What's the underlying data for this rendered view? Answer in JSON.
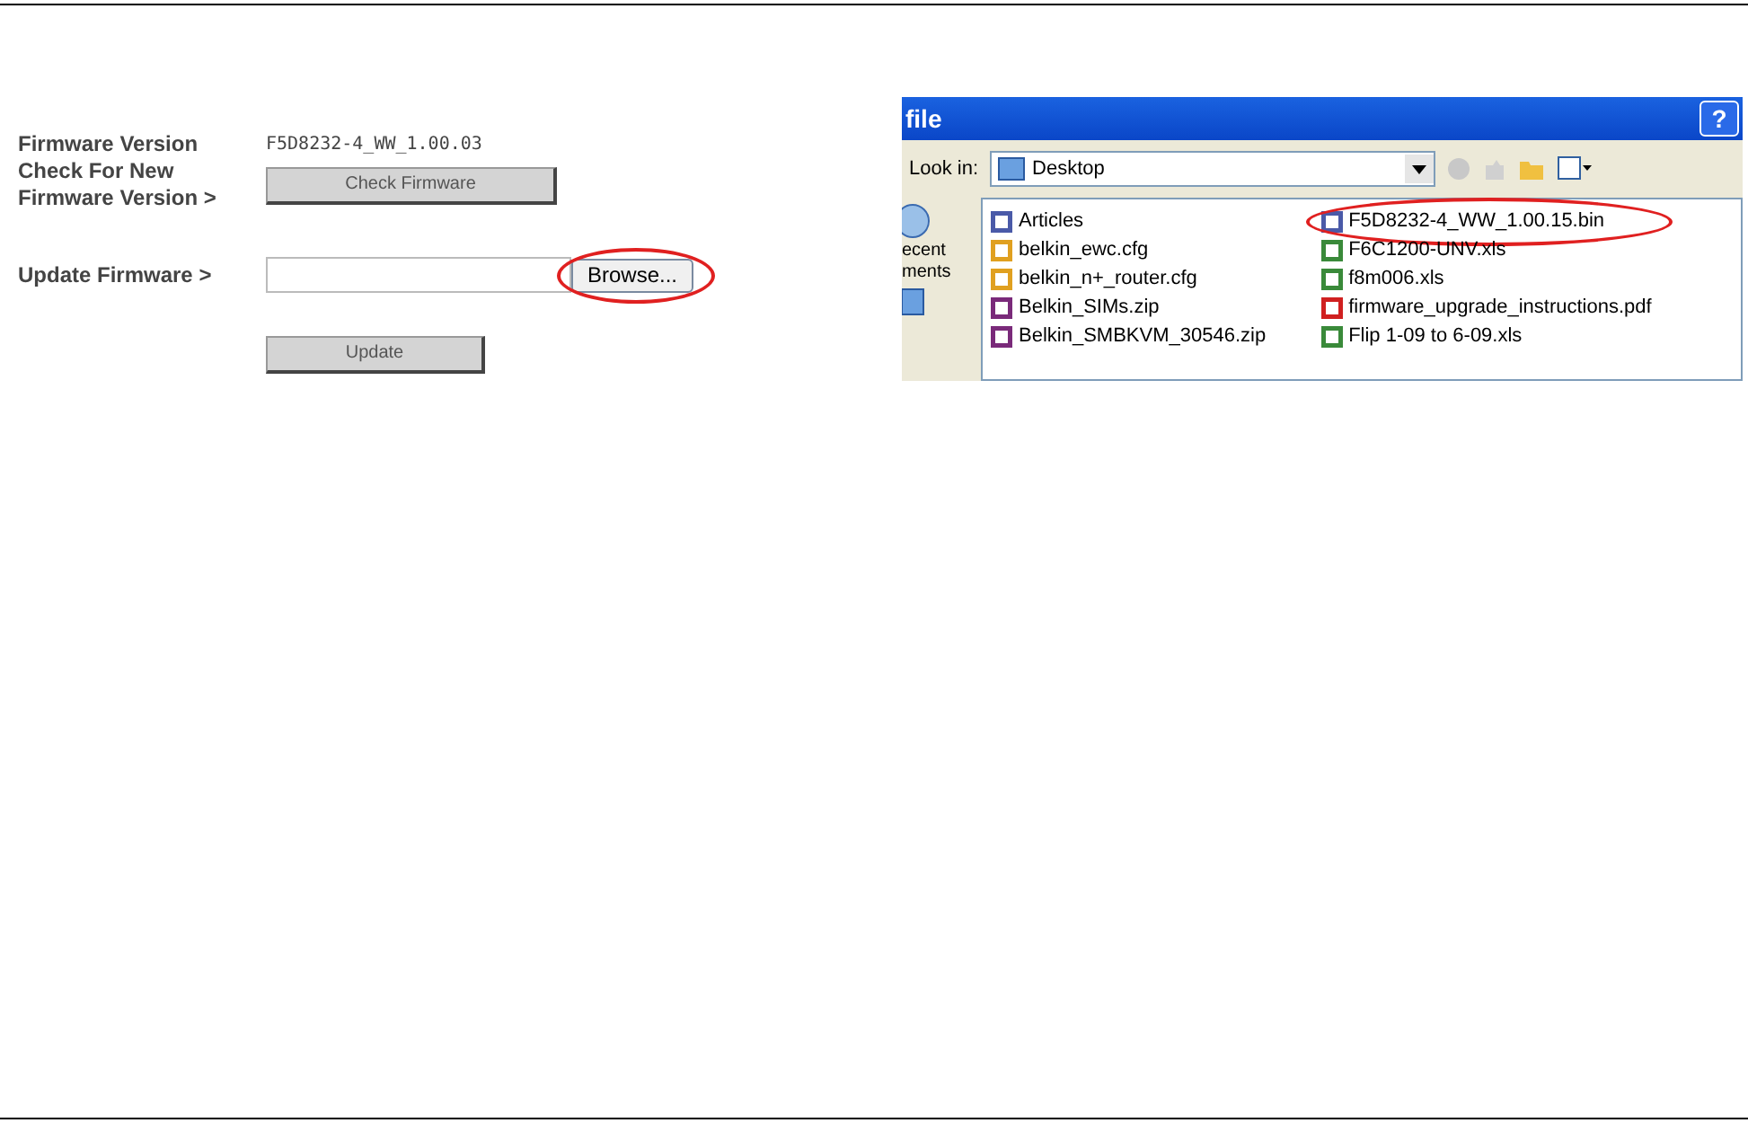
{
  "firmware_form": {
    "rows": [
      {
        "kind": "text",
        "label": "Firmware Version",
        "value": "F5D8232-4_WW_1.00.03"
      },
      {
        "kind": "button",
        "label": "Check For New Firmware Version >",
        "button": "Check Firmware"
      },
      {
        "kind": "file",
        "label": "Update Firmware >",
        "button": "Browse...",
        "placeholder": "",
        "highlighted": true
      },
      {
        "kind": "button",
        "label": "",
        "button": "Update"
      }
    ]
  },
  "file_dialog": {
    "title": "file",
    "help": "?",
    "look_in_label": "Look in:",
    "look_in_value": "Desktop",
    "places": [
      "ecent",
      "ments"
    ],
    "files": [
      {
        "name": "Articles",
        "kind": "bin",
        "highlighted": false
      },
      {
        "name": "belkin_ewc.cfg",
        "kind": "cfg",
        "highlighted": false
      },
      {
        "name": "belkin_n+_router.cfg",
        "kind": "cfg",
        "highlighted": false
      },
      {
        "name": "Belkin_SIMs.zip",
        "kind": "zip",
        "highlighted": false
      },
      {
        "name": "Belkin_SMBKVM_30546.zip",
        "kind": "zip",
        "highlighted": false
      },
      {
        "name": "F5D8232-4_WW_1.00.15.bin",
        "kind": "bin",
        "highlighted": true
      },
      {
        "name": "F6C1200-UNV.xls",
        "kind": "xls",
        "highlighted": false
      },
      {
        "name": "f8m006.xls",
        "kind": "xls",
        "highlighted": false
      },
      {
        "name": "firmware_upgrade_instructions.pdf",
        "kind": "pdf",
        "highlighted": false
      },
      {
        "name": "Flip 1-09 to 6-09.xls",
        "kind": "xls",
        "highlighted": false
      }
    ]
  }
}
